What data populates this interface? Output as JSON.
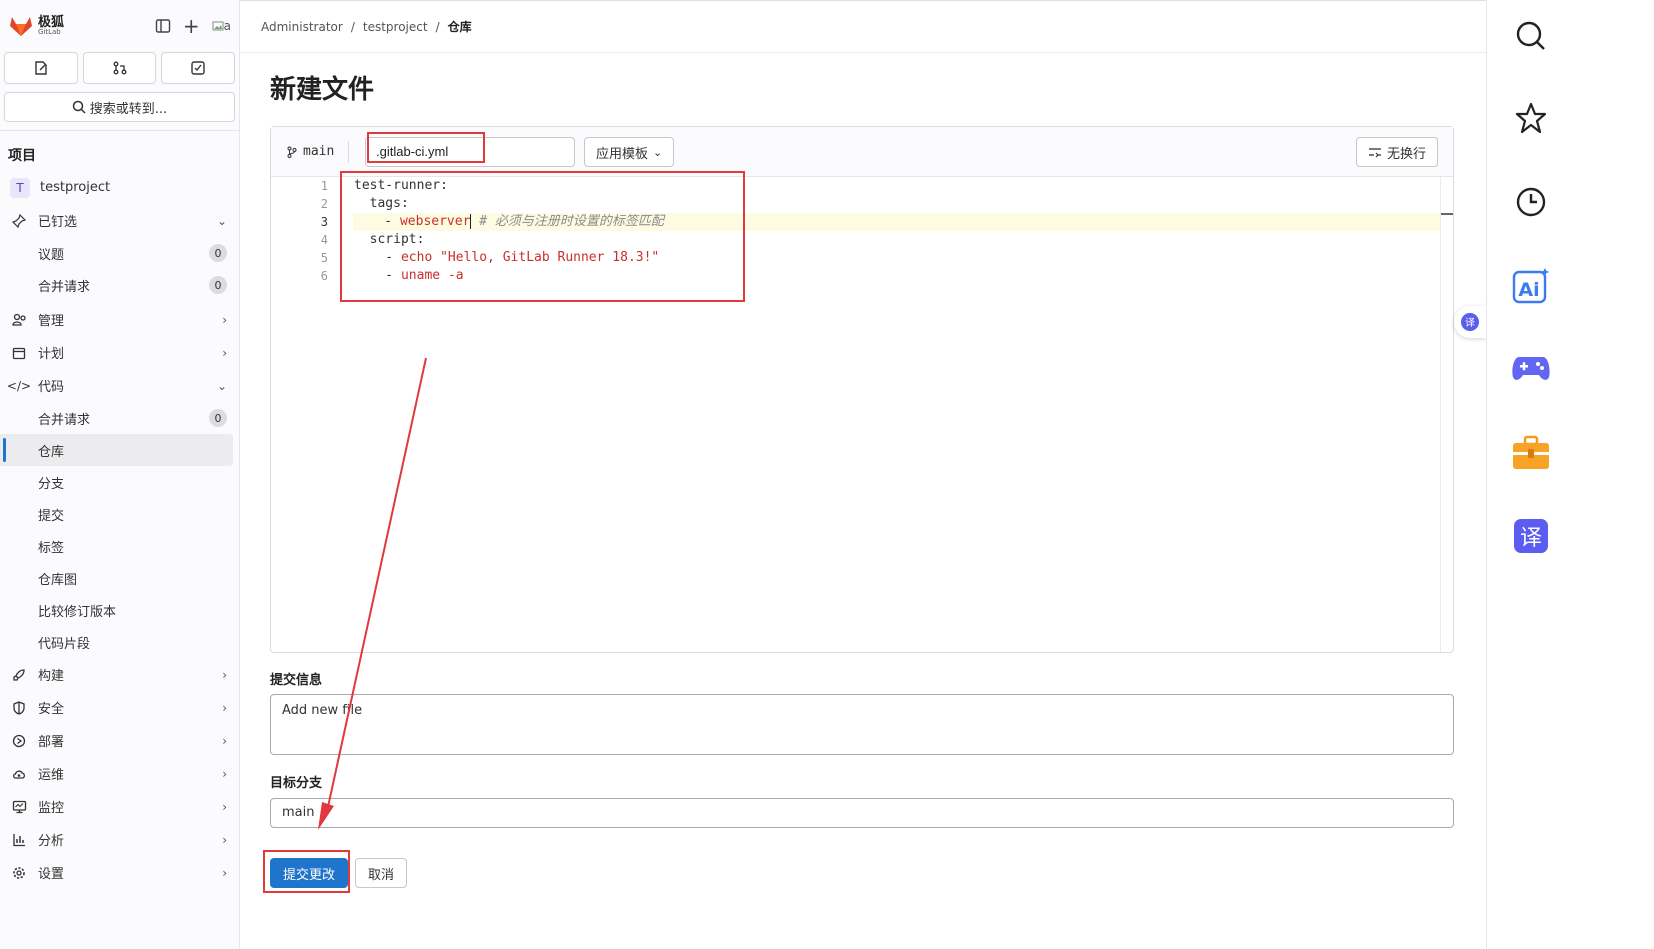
{
  "brand": {
    "name_cn": "极狐",
    "name_en": "GitLab"
  },
  "sidebar": {
    "search_label": "搜索或转到...",
    "section_title": "项目",
    "project": {
      "avatar": "T",
      "name": "testproject"
    },
    "pinned": {
      "label": "已钉选",
      "items": [
        {
          "label": "议题",
          "count": "0"
        },
        {
          "label": "合并请求",
          "count": "0"
        }
      ]
    },
    "groups": {
      "manage": "管理",
      "plan": "计划",
      "code": "代码",
      "build": "构建",
      "secure": "安全",
      "deploy": "部署",
      "operate": "运维",
      "monitor": "监控",
      "analyze": "分析",
      "settings": "设置"
    },
    "code_items": [
      {
        "label": "合并请求",
        "count": "0"
      },
      {
        "label": "仓库"
      },
      {
        "label": "分支"
      },
      {
        "label": "提交"
      },
      {
        "label": "标签"
      },
      {
        "label": "仓库图"
      },
      {
        "label": "比较修订版本"
      },
      {
        "label": "代码片段"
      }
    ]
  },
  "breadcrumb": [
    "Administrator",
    "testproject",
    "仓库"
  ],
  "page_title": "新建文件",
  "editor": {
    "branch": "main",
    "filename": ".gitlab-ci.yml",
    "template_button": "应用模板",
    "wrap_button": "无换行",
    "line_numbers": [
      "1",
      "2",
      "3",
      "4",
      "5",
      "6"
    ],
    "code": {
      "l1": "test-runner:",
      "l2": "  tags:",
      "l3_dash": "    - ",
      "l3_val": "webserver",
      "l3_comment": " # 必须与注册时设置的标签匹配",
      "l4": "  script:",
      "l5_dash": "    - ",
      "l5_val": "echo \"Hello, GitLab Runner 18.3!\"",
      "l6_dash": "    - ",
      "l6_val": "uname -a"
    }
  },
  "commit": {
    "message_label": "提交信息",
    "message_value": "Add new file",
    "target_label": "目标分支",
    "target_value": "main",
    "commit_button": "提交更改",
    "cancel_button": "取消"
  },
  "avatar_alt": "a",
  "colors": {
    "accent": "#1f75cb",
    "annotation": "#e0393e",
    "brand": "#e24329"
  },
  "right_panel": {
    "ai_label": "Ai",
    "translate_label": "译"
  }
}
